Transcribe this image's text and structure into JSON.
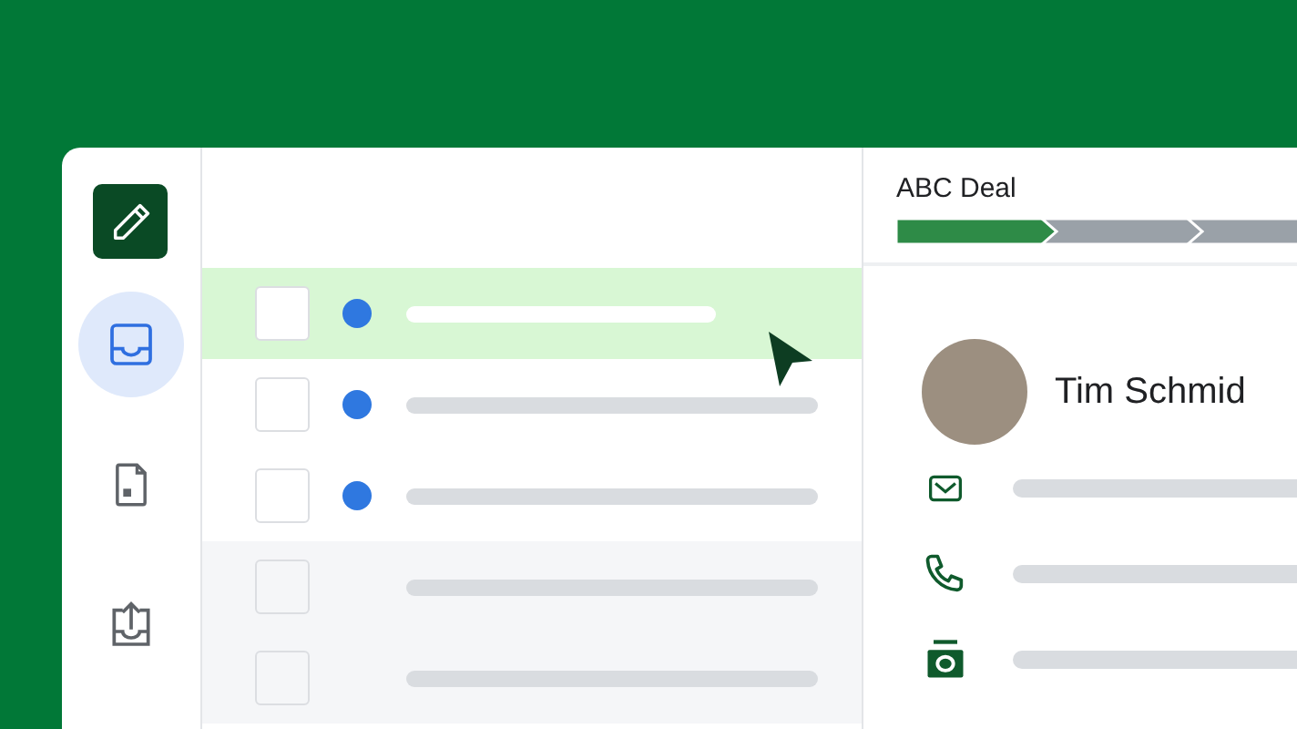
{
  "sidebar": {
    "items": [
      {
        "kind": "inbox",
        "selected": true
      },
      {
        "kind": "file",
        "selected": false
      },
      {
        "kind": "upload",
        "selected": false
      }
    ]
  },
  "list": {
    "rows": [
      {
        "selected": true,
        "unread": true
      },
      {
        "selected": false,
        "unread": true
      },
      {
        "selected": false,
        "unread": true
      },
      {
        "selected": false,
        "unread": false
      },
      {
        "selected": false,
        "unread": false
      }
    ]
  },
  "deal": {
    "title": "ABC Deal",
    "stages": [
      {
        "done": true
      },
      {
        "done": false
      },
      {
        "done": false
      }
    ]
  },
  "contact": {
    "name": "Tim Schmid",
    "fields": [
      {
        "kind": "email"
      },
      {
        "kind": "phone"
      },
      {
        "kind": "money"
      }
    ]
  }
}
